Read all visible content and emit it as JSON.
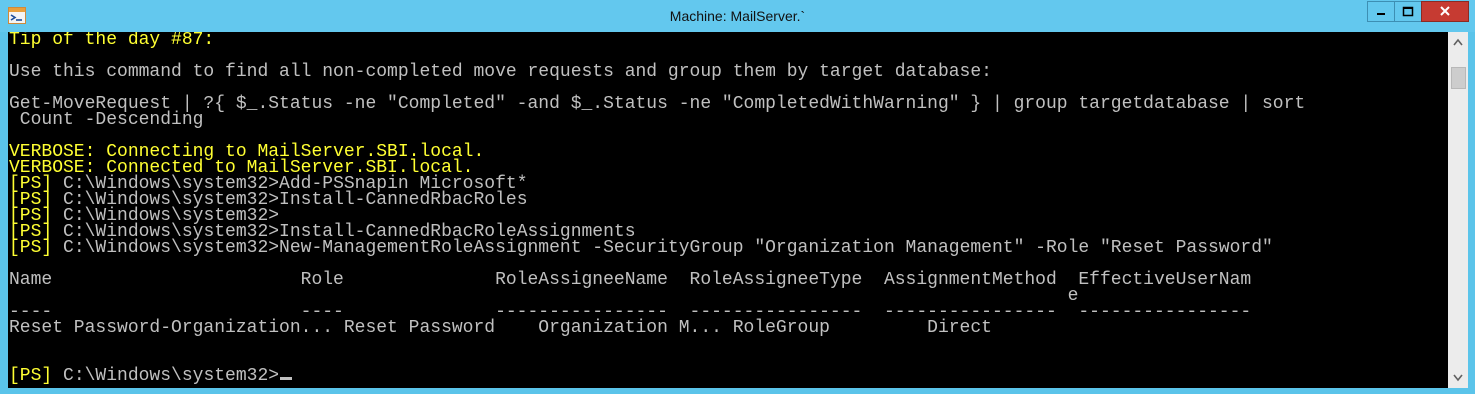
{
  "window": {
    "title": "Machine: MailServer.`",
    "accent_color": "#63c8ee",
    "close_color": "#c63b32",
    "icons": {
      "app": "powershell-icon",
      "minimize": "minimize-icon",
      "maximize": "maximize-icon",
      "close": "close-icon"
    }
  },
  "console": {
    "background": "#000000",
    "text_color": "#c0c0c0",
    "highlight_color": "#ffff32",
    "lines": [
      {
        "text": "Tip of the day #87:",
        "style": "y"
      },
      {
        "text": "",
        "style": "g"
      },
      {
        "text": "Use this command to find all non-completed move requests and group them by target database:",
        "style": "g"
      },
      {
        "text": "",
        "style": "g"
      },
      {
        "text": "Get-MoveRequest | ?{ $_.Status -ne \"Completed\" -and $_.Status -ne \"CompletedWithWarning\" } | group targetdatabase | sort",
        "style": "g"
      },
      {
        "text": " Count -Descending",
        "style": "g"
      },
      {
        "text": "",
        "style": "g"
      },
      {
        "text": "VERBOSE: Connecting to MailServer.SBI.local.",
        "style": "y"
      },
      {
        "text": "VERBOSE: Connected to MailServer.SBI.local.",
        "style": "y"
      },
      {
        "prompt": "[PS]",
        "text": " C:\\Windows\\system32>Add-PSSnapin Microsoft*"
      },
      {
        "prompt": "[PS]",
        "text": " C:\\Windows\\system32>Install-CannedRbacRoles"
      },
      {
        "prompt": "[PS]",
        "text": " C:\\Windows\\system32>"
      },
      {
        "prompt": "[PS]",
        "text": " C:\\Windows\\system32>Install-CannedRbacRoleAssignments"
      },
      {
        "prompt": "[PS]",
        "text": " C:\\Windows\\system32>New-ManagementRoleAssignment -SecurityGroup \"Organization Management\" -Role \"Reset Password\""
      },
      {
        "text": "",
        "style": "g"
      },
      {
        "text": "Name                       Role              RoleAssigneeName  RoleAssigneeType  AssignmentMethod  EffectiveUserNam",
        "style": "g"
      },
      {
        "text": "                                                                                                  e",
        "style": "g"
      },
      {
        "text": "----                       ----              ----------------  ----------------  ----------------  ----------------",
        "style": "g"
      },
      {
        "text": "Reset Password-Organization... Reset Password    Organization M... RoleGroup         Direct",
        "style": "g"
      },
      {
        "text": "",
        "style": "g"
      },
      {
        "text": "",
        "style": "g"
      },
      {
        "prompt": "[PS]",
        "text": " C:\\Windows\\system32>",
        "cursor": true
      }
    ]
  }
}
